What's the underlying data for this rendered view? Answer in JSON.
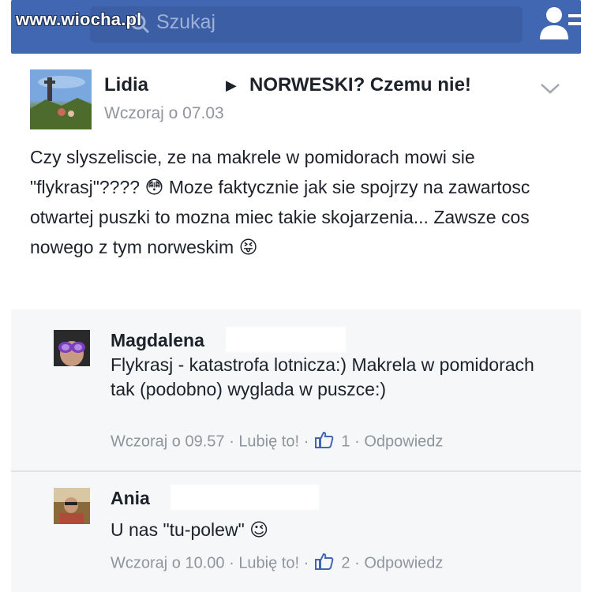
{
  "watermark": "www.wiocha.pl",
  "search": {
    "placeholder": "Szukaj"
  },
  "colors": {
    "brand": "#4267b2",
    "meta_text": "#90949c",
    "link_blue": "#4267b2"
  },
  "icons": {
    "search": "search-icon",
    "friends": "friend-requests-icon",
    "options": "chevron-down-icon",
    "like": "thumbs-up-icon"
  },
  "post": {
    "author": "Lidia",
    "group": "NORWESKI? Czemu nie!",
    "arrow": "▶",
    "time": "Wczoraj o 07.03",
    "text": "Czy slyszeliscie, ze na makrele w pomidorach mowi sie \"flykrasj\"???? 😳 Moze faktycznie jak sie spojrzy na zawartosc otwartej puszki to mozna miec takie skojarzenia... Zawsze cos nowego z tym norweskim 😝"
  },
  "comments": [
    {
      "name": "Magdalena",
      "text": "Flykrasj - katastrofa lotnicza:) Makrela w pomidorach tak (podobno) wyglada w puszce:)",
      "time": "Wczoraj o 09.57",
      "like_label": "Lubię to!",
      "likes": "1",
      "reply_label": "Odpowiedz",
      "sep": "·"
    },
    {
      "name": "Ania",
      "text": "U nas \"tu-polew\" 😉",
      "time": "Wczoraj o 10.00",
      "like_label": "Lubię to!",
      "likes": "2",
      "reply_label": "Odpowiedz",
      "sep": "·"
    }
  ]
}
